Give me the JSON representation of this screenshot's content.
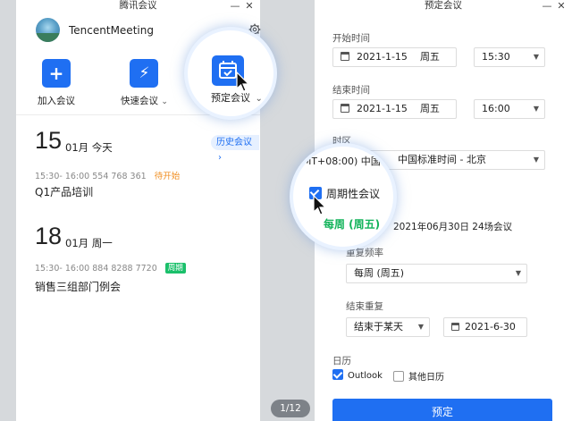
{
  "left_window": {
    "title": "腾讯会议",
    "controls": {
      "minimize": "—",
      "close": "✕"
    },
    "user": {
      "name": "TencentMeeting"
    },
    "actions": [
      {
        "label": "加入会议",
        "icon": "plus-icon",
        "glyph": "+",
        "dropdown": false
      },
      {
        "label": "快速会议",
        "icon": "lightning-icon",
        "glyph": "⚡",
        "dropdown": true
      },
      {
        "label": "预定会议",
        "icon": "calendar-icon",
        "glyph": "",
        "dropdown": true
      }
    ],
    "history_button": "历史会议",
    "days": [
      {
        "day": "15",
        "label": "01月 今天",
        "meetings": [
          {
            "time": "15:30- 16:00",
            "id": "554 768 361",
            "status": "待开始",
            "title": "Q1产品培训"
          }
        ]
      },
      {
        "day": "18",
        "label": "01月 周一",
        "meetings": [
          {
            "time": "15:30- 16:00",
            "id": "884 8288 7720",
            "badge": "周期",
            "title": "销售三组部门例会"
          }
        ]
      }
    ]
  },
  "page_indicator": "1/12",
  "right_window": {
    "title": "预定会议",
    "controls": {
      "minimize": "—",
      "close": "✕"
    },
    "start": {
      "label": "开始时间",
      "date": "2021-1-15",
      "weekday": "周五",
      "time": "15:30"
    },
    "end": {
      "label": "结束时间",
      "date": "2021-1-15",
      "weekday": "周五",
      "time": "16:00"
    },
    "timezone": {
      "label": "时区",
      "value": "(GMT+08:00) 中国标准时间 - 北京"
    },
    "recurring": {
      "label": "周期性会议",
      "checked": true,
      "green_text": "每周 (周五)",
      "summary": "每周 (周五)，2021年06月30日 24场会议"
    },
    "frequency": {
      "label": "重复频率",
      "value": "每周 (周五)"
    },
    "end_repeat": {
      "label": "结束重复",
      "mode": "结束于某天",
      "date": "2021-6-30"
    },
    "calendar": {
      "label": "日历",
      "options": [
        {
          "label": "Outlook",
          "checked": true
        },
        {
          "label": "其他日历",
          "checked": false
        }
      ]
    },
    "submit_label": "预定"
  },
  "colors": {
    "accent": "#1f6ff2",
    "pending": "#f08c1e",
    "weekly_badge": "#1bc06b"
  }
}
